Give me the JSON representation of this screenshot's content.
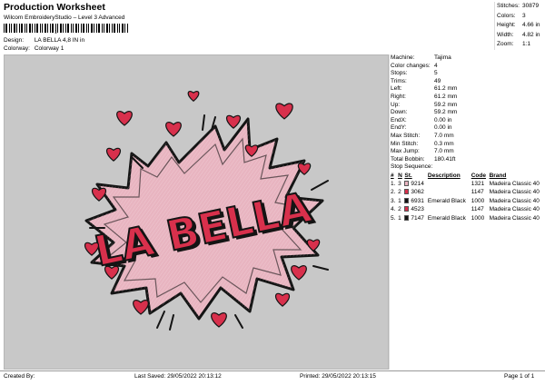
{
  "header": {
    "title": "Production Worksheet",
    "subtitle": "Wilcom EmbroideryStudio – Level 3 Advanced",
    "barcode_digits": "1"
  },
  "meta": {
    "design_label": "Design:",
    "design_value": "LA BELLA 4,8 IN in",
    "colorway_label": "Colorway:",
    "colorway_value": "Colorway 1"
  },
  "stats": [
    {
      "label": "Stitches:",
      "value": "30879"
    },
    {
      "label": "Colors:",
      "value": "3"
    },
    {
      "label": "Height:",
      "value": "4.66 in"
    },
    {
      "label": "Width:",
      "value": "4.82 in"
    },
    {
      "label": "Zoom:",
      "value": "1:1"
    }
  ],
  "design": {
    "text": "LA BELLA",
    "background": "#c8c8c8",
    "burst_fill": "#e8b4c0",
    "heart_color": "#d8304c",
    "text_color": "#d8304c",
    "outline_color": "#141414"
  },
  "machine_info": [
    {
      "label": "Machine:",
      "value": "Tajima"
    },
    {
      "label": "Color changes:",
      "value": "4"
    },
    {
      "label": "Stops:",
      "value": "5"
    },
    {
      "label": "Trims:",
      "value": "49"
    },
    {
      "label": "Left:",
      "value": "61.2 mm"
    },
    {
      "label": "Right:",
      "value": "61.2 mm"
    },
    {
      "label": "Up:",
      "value": "59.2 mm"
    },
    {
      "label": "Down:",
      "value": "59.2 mm"
    },
    {
      "label": "EndX:",
      "value": "0.00 in"
    },
    {
      "label": "EndY:",
      "value": "0.00 in"
    },
    {
      "label": "Max Stitch:",
      "value": "7.0 mm"
    },
    {
      "label": "Min Stitch:",
      "value": "0.3 mm"
    },
    {
      "label": "Max Jump:",
      "value": "7.0 mm"
    },
    {
      "label": "Total Bobbin:",
      "value": "180.41ft"
    }
  ],
  "stop_sequence": {
    "title": "Stop Sequence:",
    "headers": [
      "#",
      "N",
      "St.",
      "Description",
      "Code",
      "Brand"
    ],
    "rows": [
      {
        "num": "1.",
        "n": "3",
        "st": "9214",
        "desc": "",
        "code": "1321",
        "brand": "Madeira Classic 40",
        "color": "#e8b4c0"
      },
      {
        "num": "2.",
        "n": "2",
        "st": "3062",
        "desc": "",
        "code": "1147",
        "brand": "Madeira Classic 40",
        "color": "#d8304c"
      },
      {
        "num": "3.",
        "n": "1",
        "st": "6931",
        "desc": "Emerald Black",
        "code": "1000",
        "brand": "Madeira Classic 40",
        "color": "#141414"
      },
      {
        "num": "4.",
        "n": "2",
        "st": "4523",
        "desc": "",
        "code": "1147",
        "brand": "Madeira Classic 40",
        "color": "#d8304c"
      },
      {
        "num": "5.",
        "n": "1",
        "st": "7147",
        "desc": "Emerald Black",
        "code": "1000",
        "brand": "Madeira Classic 40",
        "color": "#141414"
      }
    ]
  },
  "footer": {
    "created_by": "Created By:",
    "last_saved": "Last Saved: 29/05/2022 20:13:12",
    "printed": "Printed: 29/05/2022 20:13:15",
    "page": "Page 1 of 1"
  }
}
